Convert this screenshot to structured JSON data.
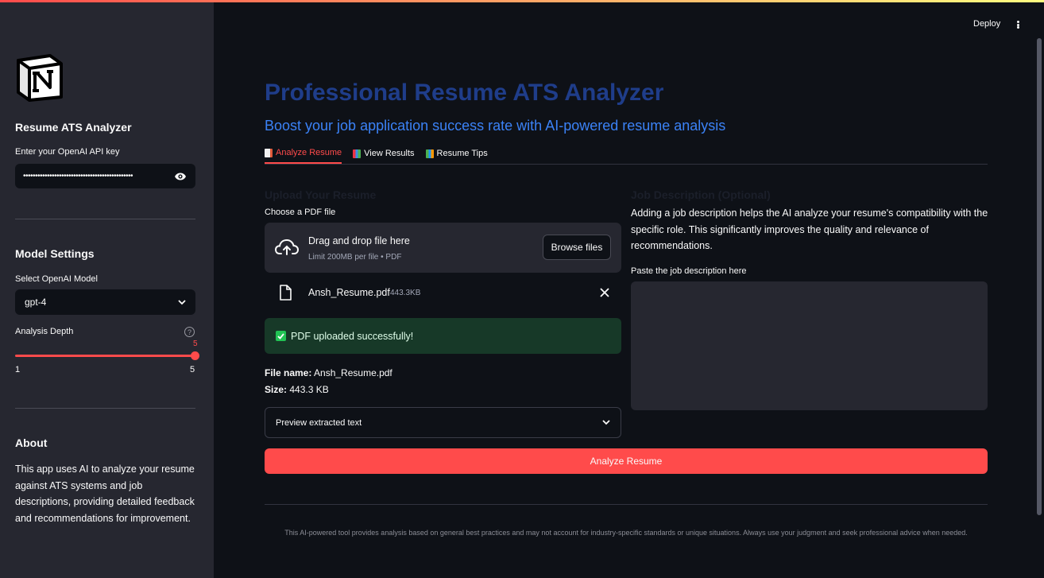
{
  "header": {
    "deploy_label": "Deploy"
  },
  "sidebar": {
    "logo": "notion-logo",
    "title": "Resume ATS Analyzer",
    "api_key_label": "Enter your OpenAI API key",
    "api_key_value": "••••••••••••••••••••••••••••••••••••••••••••••",
    "model_settings_heading": "Model Settings",
    "model_label": "Select OpenAI Model",
    "model_value": "gpt-4",
    "depth_label": "Analysis Depth",
    "depth_help": "?",
    "depth": {
      "value": "5",
      "min": "1",
      "max": "5"
    },
    "about_heading": "About",
    "about_text": "This app uses AI to analyze your resume against ATS systems and job descriptions, providing detailed feedback and recommendations for improvement."
  },
  "main": {
    "title": "Professional Resume ATS Analyzer",
    "subtitle": "Boost your job application success rate with AI-powered resume analysis",
    "tabs": [
      {
        "label": "Analyze Resume",
        "active": true,
        "icon": "memo-icon"
      },
      {
        "label": "View Results",
        "active": false,
        "icon": "chart-icon"
      },
      {
        "label": "Resume Tips",
        "active": false,
        "icon": "books-icon"
      }
    ],
    "upload": {
      "heading": "Upload Your Resume",
      "file_label": "Choose a PDF file",
      "drop_text": "Drag and drop file here",
      "limit_text": "Limit 200MB per file • PDF",
      "browse_label": "Browse files",
      "file_name": "Ansh_Resume.pdf",
      "file_size": "443.3KB",
      "success_text": "PDF uploaded successfully!",
      "info_name_label": "File name:",
      "info_name_value": "Ansh_Resume.pdf",
      "info_size_label": "Size:",
      "info_size_value": "443.3 KB",
      "preview_label": "Preview extracted text"
    },
    "job": {
      "heading": "Job Description (Optional)",
      "help_text": "Adding a job description helps the AI analyze your resume's compatibility with the specific role. This significantly improves the quality and relevance of recommendations.",
      "textarea_label": "Paste the job description here",
      "textarea_value": ""
    },
    "analyze_button": "Analyze Resume",
    "footer": "This AI-powered tool provides analysis based on general best practices and may not account for industry-specific standards or unique situations. Always use your judgment and seek professional advice when needed."
  },
  "colors": {
    "accent": "#ff4b4b",
    "title": "#1f3d8a",
    "subtitle": "#3b82f6",
    "success_bg": "#173928"
  }
}
